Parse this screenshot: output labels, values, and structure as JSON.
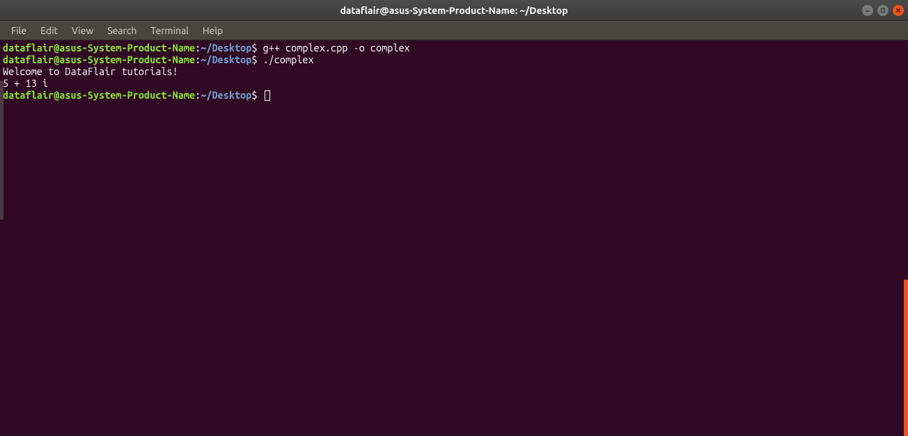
{
  "window": {
    "title": "dataflair@asus-System-Product-Name: ~/Desktop"
  },
  "menubar": {
    "items": [
      "File",
      "Edit",
      "View",
      "Search",
      "Terminal",
      "Help"
    ]
  },
  "prompt": {
    "user_host": "dataflair@asus-System-Product-Name",
    "colon": ":",
    "path_tilde": "~/",
    "path_dir": "Desktop",
    "dollar": "$"
  },
  "terminal": {
    "lines": [
      {
        "type": "prompt",
        "command": "g++ complex.cpp -o complex"
      },
      {
        "type": "prompt",
        "command": "./complex"
      },
      {
        "type": "output",
        "text": "Welcome to DataFlair tutorials!"
      },
      {
        "type": "blank",
        "text": ""
      },
      {
        "type": "output",
        "text": "5 + 13 i"
      },
      {
        "type": "prompt_cursor",
        "command": ""
      }
    ]
  }
}
